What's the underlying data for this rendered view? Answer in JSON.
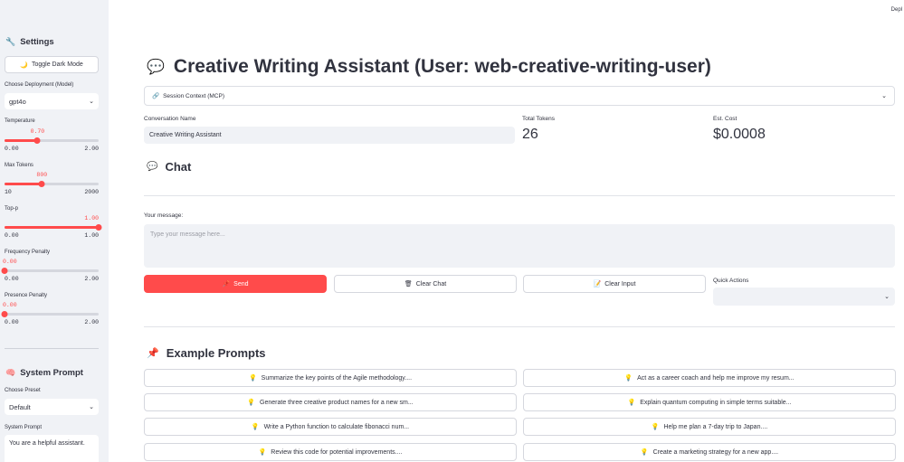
{
  "sidebar": {
    "settings_title": "Settings",
    "toggle_dark_label": "Toggle Dark Mode",
    "deployment_label": "Choose Deployment (Model)",
    "deployment_value": "gpt4o",
    "sliders": [
      {
        "label": "Temperature",
        "value": 0.7,
        "value_text": "0.70",
        "min": 0,
        "max": 2,
        "min_text": "0.00",
        "max_text": "2.00"
      },
      {
        "label": "Max Tokens",
        "value": 800,
        "value_text": "800",
        "min": 10,
        "max": 2000,
        "min_text": "10",
        "max_text": "2000"
      },
      {
        "label": "Top-p",
        "value": 1,
        "value_text": "1.00",
        "min": 0,
        "max": 1,
        "min_text": "0.00",
        "max_text": "1.00"
      },
      {
        "label": "Frequency Penalty",
        "value": 0,
        "value_text": "0.00",
        "min": 0,
        "max": 2,
        "min_text": "0.00",
        "max_text": "2.00"
      },
      {
        "label": "Presence Penalty",
        "value": 0,
        "value_text": "0.00",
        "min": 0,
        "max": 2,
        "min_text": "0.00",
        "max_text": "2.00"
      }
    ],
    "system_prompt_title": "System Prompt",
    "preset_label": "Choose Preset",
    "preset_value": "Default",
    "system_prompt_label": "System Prompt",
    "system_prompt_value": "You are a helpful assistant."
  },
  "header": {
    "deploy_label": "Depl",
    "title": "Creative Writing Assistant (User: web-creative-writing-user)"
  },
  "session": {
    "expander_label": "Session Context (MCP)"
  },
  "conversation": {
    "name_label": "Conversation Name",
    "name_value": "Creative Writing Assistant",
    "tokens_label": "Total Tokens",
    "tokens_value": "26",
    "cost_label": "Est. Cost",
    "cost_value": "$0.0008"
  },
  "chat": {
    "title": "Chat",
    "message_label": "Your message:",
    "message_placeholder": "Type your message here...",
    "send_label": "Send",
    "clear_chat_label": "Clear Chat",
    "clear_input_label": "Clear Input",
    "quick_actions_label": "Quick Actions"
  },
  "examples": {
    "title": "Example Prompts",
    "prompts": [
      "Summarize the key points of the Agile methodology....",
      "Act as a career coach and help me improve my resum...",
      "Generate three creative product names for a new sm...",
      "Explain quantum computing in simple terms suitable...",
      "Write a Python function to calculate fibonacci num...",
      "Help me plan a 7-day trip to Japan....",
      "Review this code for potential improvements....",
      "Create a marketing strategy for a new app...."
    ]
  },
  "colors": {
    "accent": "#ff4b4b",
    "sidebar_bg": "#f0f2f6",
    "text": "#31333f"
  },
  "icons": {
    "settings": "wrench-icon",
    "dark_mode": "crescent-moon-icon",
    "system_prompt": "brain-icon",
    "title": "speech-balloon-icon",
    "session": "link-icon",
    "chat": "speech-balloon-icon",
    "send": "pushpin-icon",
    "clear_chat": "wastebasket-icon",
    "clear_input": "memo-icon",
    "examples": "pushpin-icon",
    "prompt": "lightbulb-icon"
  }
}
